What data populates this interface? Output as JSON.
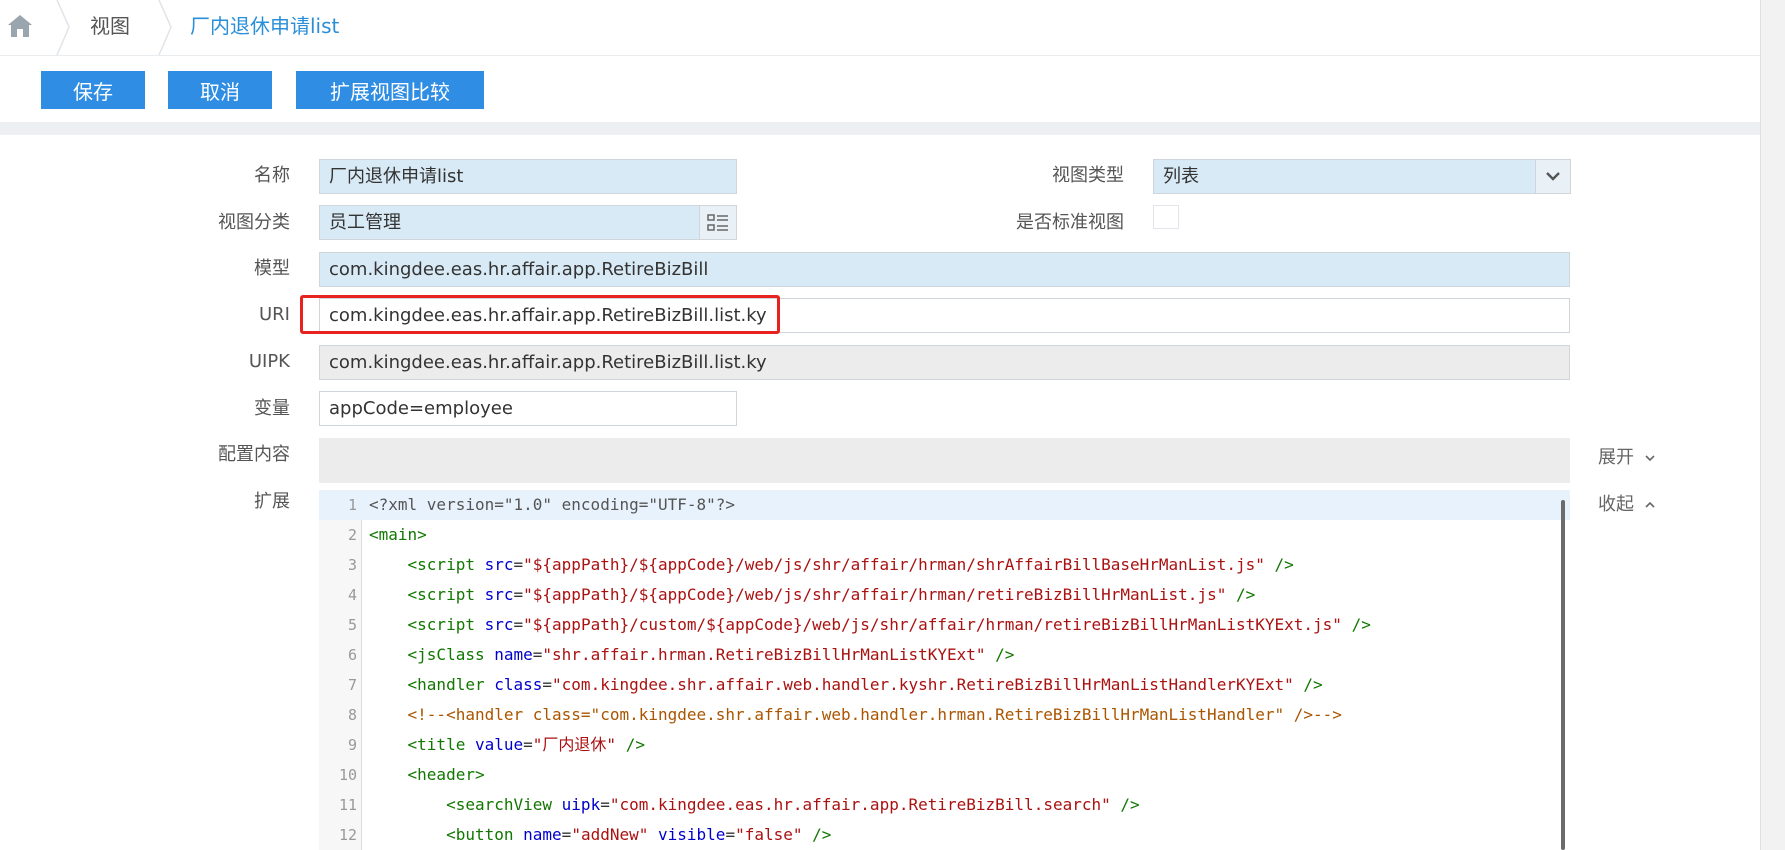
{
  "breadcrumb": {
    "view": "视图",
    "current": "厂内退休申请list"
  },
  "toolbar": {
    "save": "保存",
    "cancel": "取消",
    "compare": "扩展视图比较"
  },
  "form": {
    "name_label": "名称",
    "name_value": "厂内退休申请list",
    "view_type_label": "视图类型",
    "view_type_value": "列表",
    "category_label": "视图分类",
    "category_value": "员工管理",
    "is_standard_label": "是否标准视图",
    "is_standard_checked": false,
    "model_label": "模型",
    "model_value": "com.kingdee.eas.hr.affair.app.RetireBizBill",
    "uri_label": "URI",
    "uri_value": "com.kingdee.eas.hr.affair.app.RetireBizBill.list.ky",
    "uipk_label": "UIPK",
    "uipk_value": "com.kingdee.eas.hr.affair.app.RetireBizBill.list.ky",
    "variable_label": "变量",
    "variable_value": "appCode=employee",
    "config_label": "配置内容",
    "expand_label": "展开",
    "ext_label": "扩展",
    "collapse_label": "收起"
  },
  "code_lines": [
    {
      "n": "1",
      "text": "<?xml version=\"1.0\" encoding=\"UTF-8\"?>"
    },
    {
      "n": "2",
      "text": "<main>"
    },
    {
      "n": "3",
      "text": "    <script src=\"${appPath}/${appCode}/web/js/shr/affair/hrman/shrAffairBillBaseHrManList.js\" />"
    },
    {
      "n": "4",
      "text": "    <script src=\"${appPath}/${appCode}/web/js/shr/affair/hrman/retireBizBillHrManList.js\" />"
    },
    {
      "n": "5",
      "text": "    <script src=\"${appPath}/custom/${appCode}/web/js/shr/affair/hrman/retireBizBillHrManListKYExt.js\" />"
    },
    {
      "n": "6",
      "text": "    <jsClass name=\"shr.affair.hrman.RetireBizBillHrManListKYExt\" />"
    },
    {
      "n": "7",
      "text": "    <handler class=\"com.kingdee.shr.affair.web.handler.kyshr.RetireBizBillHrManListHandlerKYExt\" />"
    },
    {
      "n": "8",
      "text": "    <!--<handler class=\"com.kingdee.shr.affair.web.handler.hrman.RetireBizBillHrManListHandler\" />-->"
    },
    {
      "n": "9",
      "text": "    <title value=\"厂内退休\" />"
    },
    {
      "n": "10",
      "text": "    <header>"
    },
    {
      "n": "11",
      "text": "        <searchView uipk=\"com.kingdee.eas.hr.affair.app.RetireBizBill.search\" />"
    },
    {
      "n": "12",
      "text": "        <button name=\"addNew\" visible=\"false\" />"
    }
  ],
  "colors": {
    "primary": "#2f8ee3",
    "field_bg": "#d8eaf5",
    "highlight": "#e8231f",
    "breadcrumb_active": "#2a8fd8"
  }
}
